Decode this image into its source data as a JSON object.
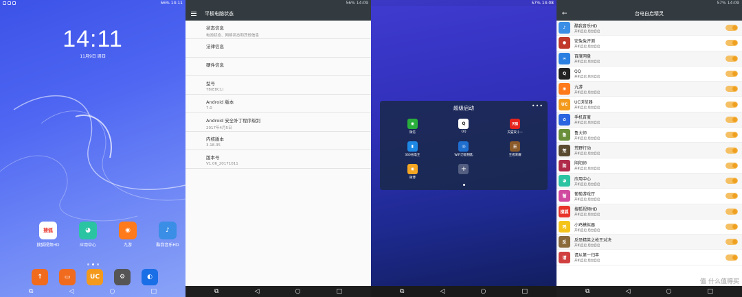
{
  "panel1": {
    "status_right": "56% 14:11",
    "clock": "14:11",
    "date": "11月9日 周四",
    "apps": [
      {
        "label": "搜狐视频HD",
        "icon_text": "搜狐",
        "color": "#e8332a"
      },
      {
        "label": "应用中心",
        "icon_text": "◕",
        "color": "#2bc4a3"
      },
      {
        "label": "九游",
        "icon_text": "◉",
        "color": "#ff7a1a"
      },
      {
        "label": "酷我音乐HD",
        "icon_text": "♪",
        "color": "#3a8ee6"
      }
    ],
    "dock": [
      {
        "icon": "upload-icon",
        "glyph": "↑",
        "color": "#f06b1d"
      },
      {
        "icon": "toggle-app-icon",
        "glyph": "▭",
        "color": "#f06b1d"
      },
      {
        "icon": "uc-browser-icon",
        "glyph": "UC",
        "color": "#f39a1d"
      },
      {
        "icon": "settings-icon",
        "glyph": "⚙",
        "color": "#555"
      },
      {
        "icon": "browser-icon",
        "glyph": "◐",
        "color": "#1a6ee6"
      }
    ]
  },
  "panel2": {
    "status_right": "56% 14:09",
    "title": "平板电脑状态",
    "items": [
      {
        "title": "状态信息",
        "sub": "电池状态、网络状态和其他信息"
      },
      {
        "title": "法律信息",
        "sub": ""
      },
      {
        "title": "硬件信息",
        "sub": ""
      },
      {
        "title": "型号",
        "sub": "T8(E8C1)"
      },
      {
        "title": "Android 版本",
        "sub": "7.0"
      },
      {
        "title": "Android 安全补丁程序级别",
        "sub": "2017年4月5日"
      },
      {
        "title": "内核版本",
        "sub": "3.18.35"
      },
      {
        "title": "版本号",
        "sub": "V1.06_20171011"
      }
    ]
  },
  "panel3": {
    "status_right": "57% 14:08",
    "dialog_title": "超级启动",
    "apps": [
      {
        "label": "微信",
        "glyph": "◉",
        "color": "#2aae3b"
      },
      {
        "label": "QQ",
        "glyph": "Q",
        "color": "#fff"
      },
      {
        "label": "天猫双十一",
        "glyph": "天猫",
        "color": "#e4231d"
      },
      {
        "label": "360省电王",
        "glyph": "▮",
        "color": "#1e88e5"
      },
      {
        "label": "WiFi万能钥匙",
        "glyph": "◎",
        "color": "#1e6fd0"
      },
      {
        "label": "王者荣耀",
        "glyph": "王",
        "color": "#8a5a2a"
      },
      {
        "label": "微博",
        "glyph": "◉",
        "color": "#f5a623"
      }
    ]
  },
  "panel4": {
    "status_right": "57% 14:09",
    "title": "台电自启精灵",
    "sub_label": "开机自启    后台自启",
    "apps": [
      {
        "name": "酷我音乐HD",
        "glyph": "♪",
        "color": "#3a8ee6"
      },
      {
        "name": "安兔兔评测",
        "glyph": "●",
        "color": "#c0392b"
      },
      {
        "name": "百度网盘",
        "glyph": "∞",
        "color": "#2a7fe0"
      },
      {
        "name": "QQ",
        "glyph": "Q",
        "color": "#222"
      },
      {
        "name": "九游",
        "glyph": "◉",
        "color": "#ff7a1a"
      },
      {
        "name": "UC浏览器",
        "glyph": "UC",
        "color": "#f39a1d"
      },
      {
        "name": "手机百度",
        "glyph": "✿",
        "color": "#2a64e0"
      },
      {
        "name": "鲁大师",
        "glyph": "鲁",
        "color": "#6a8f3a"
      },
      {
        "name": "荒野行动",
        "glyph": "荒",
        "color": "#5a4a30"
      },
      {
        "name": "阴阳师",
        "glyph": "阴",
        "color": "#b02a4a"
      },
      {
        "name": "应用中心",
        "glyph": "◕",
        "color": "#2bc4a3"
      },
      {
        "name": "葡萄游戏厅",
        "glyph": "葡",
        "color": "#d04aa0"
      },
      {
        "name": "搜狐视频HD",
        "glyph": "搜狐",
        "color": "#e8332a"
      },
      {
        "name": "小鸡模拟器",
        "glyph": "鸡",
        "color": "#f5c41a"
      },
      {
        "name": "反恐精英之枪王对决",
        "glyph": "反",
        "color": "#8a6a3a"
      },
      {
        "name": "请从第一归丰",
        "glyph": "请",
        "color": "#d04040"
      }
    ],
    "watermark": "值 什么值得买"
  }
}
